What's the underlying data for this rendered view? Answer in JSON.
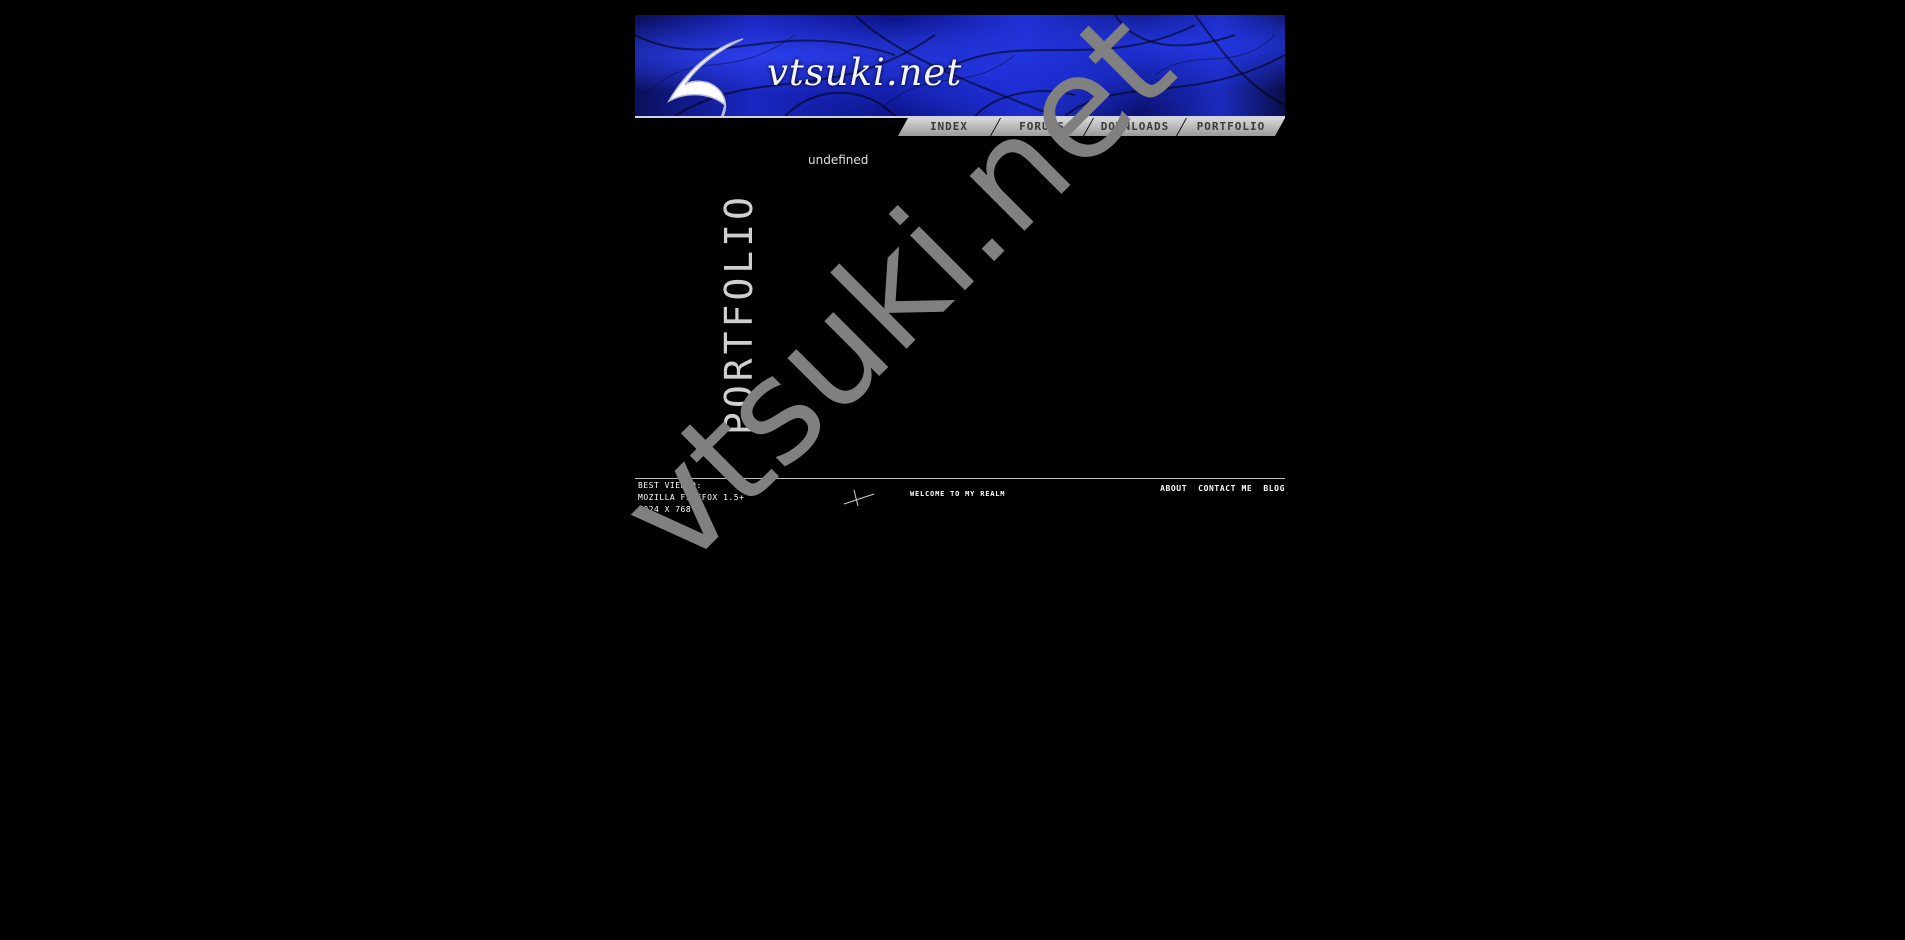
{
  "header": {
    "site_title": "vtsuki.net",
    "logo_icon": "crescent-moon-icon",
    "accent_color": "#1a27c2",
    "rule_color": "#cfd2e8"
  },
  "nav": {
    "tabs": [
      {
        "label": "Index"
      },
      {
        "label": "Forums"
      },
      {
        "label": "Downloads"
      },
      {
        "label": "Portfolio"
      }
    ]
  },
  "main": {
    "section_label": "Portfolio",
    "content_text": "undefined"
  },
  "footer": {
    "best_viewed_lines": [
      "Best viewed:",
      "Mozilla Firefox 1.5+",
      "1024 x 768"
    ],
    "welcome_text": "Welcome to my realm",
    "links": [
      {
        "label": "About"
      },
      {
        "label": "Contact me"
      },
      {
        "label": "Blog"
      }
    ]
  },
  "watermark": {
    "text": "vtsuki.net",
    "color": "#808080"
  }
}
